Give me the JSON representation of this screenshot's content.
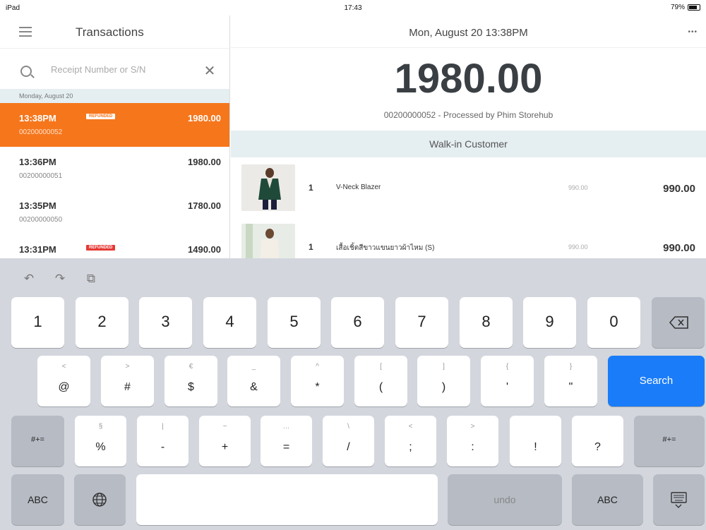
{
  "status_bar": {
    "carrier": "iPad",
    "time": "17:43",
    "battery": "79%"
  },
  "sidebar": {
    "title": "Transactions",
    "search_placeholder": "Receipt Number or S/N",
    "date_header": "Monday, August 20",
    "transactions": [
      {
        "time": "13:38PM",
        "badge": "REFUNDED",
        "amount": "1980.00",
        "number": "00200000052"
      },
      {
        "time": "13:36PM",
        "badge": "",
        "amount": "1980.00",
        "number": "00200000051"
      },
      {
        "time": "13:35PM",
        "badge": "",
        "amount": "1780.00",
        "number": "00200000050"
      },
      {
        "time": "13:31PM",
        "badge": "REFUNDED",
        "amount": "1490.00",
        "number": ""
      }
    ]
  },
  "detail": {
    "date": "Mon, August 20  13:38PM",
    "more": "•••",
    "total": "1980.00",
    "subline": "00200000052 - Processed by Phim Storehub",
    "customer": "Walk-in Customer",
    "items": [
      {
        "qty": "1",
        "name": "V-Neck Blazer",
        "unit_price": "990.00",
        "price": "990.00"
      },
      {
        "qty": "1",
        "name": "เสื้อเชิ้ตสีขาวแขนยาวผ้าไหม (S)",
        "unit_price": "990.00",
        "price": "990.00"
      }
    ]
  },
  "keyboard": {
    "tools": {
      "undo": "↶",
      "redo": "↷",
      "paste": "⧉"
    },
    "row1": [
      "1",
      "2",
      "3",
      "4",
      "5",
      "6",
      "7",
      "8",
      "9",
      "0"
    ],
    "row2": [
      {
        "main": "@",
        "sub": "<"
      },
      {
        "main": "#",
        "sub": ">"
      },
      {
        "main": "$",
        "sub": "€"
      },
      {
        "main": "&",
        "sub": "_"
      },
      {
        "main": "*",
        "sub": "^"
      },
      {
        "main": "(",
        "sub": "["
      },
      {
        "main": ")",
        "sub": "]"
      },
      {
        "main": "'",
        "sub": "{"
      },
      {
        "main": "\"",
        "sub": "}"
      }
    ],
    "row3": [
      {
        "main": "%",
        "sub": "§"
      },
      {
        "main": "-",
        "sub": "|"
      },
      {
        "main": "+",
        "sub": "~"
      },
      {
        "main": "=",
        "sub": "…"
      },
      {
        "main": "/",
        "sub": "\\"
      },
      {
        "main": ";",
        "sub": "<"
      },
      {
        "main": ":",
        "sub": ">"
      },
      {
        "main": "!",
        "sub": ""
      },
      {
        "main": "?",
        "sub": ""
      }
    ],
    "search_label": "Search",
    "symbol_toggle_label": "#+=",
    "abc_label": "ABC",
    "undo_label": "undo",
    "colors": {
      "accent": "#f6761c",
      "refund": "#e53935",
      "key_blue": "#1a7cf9"
    }
  }
}
